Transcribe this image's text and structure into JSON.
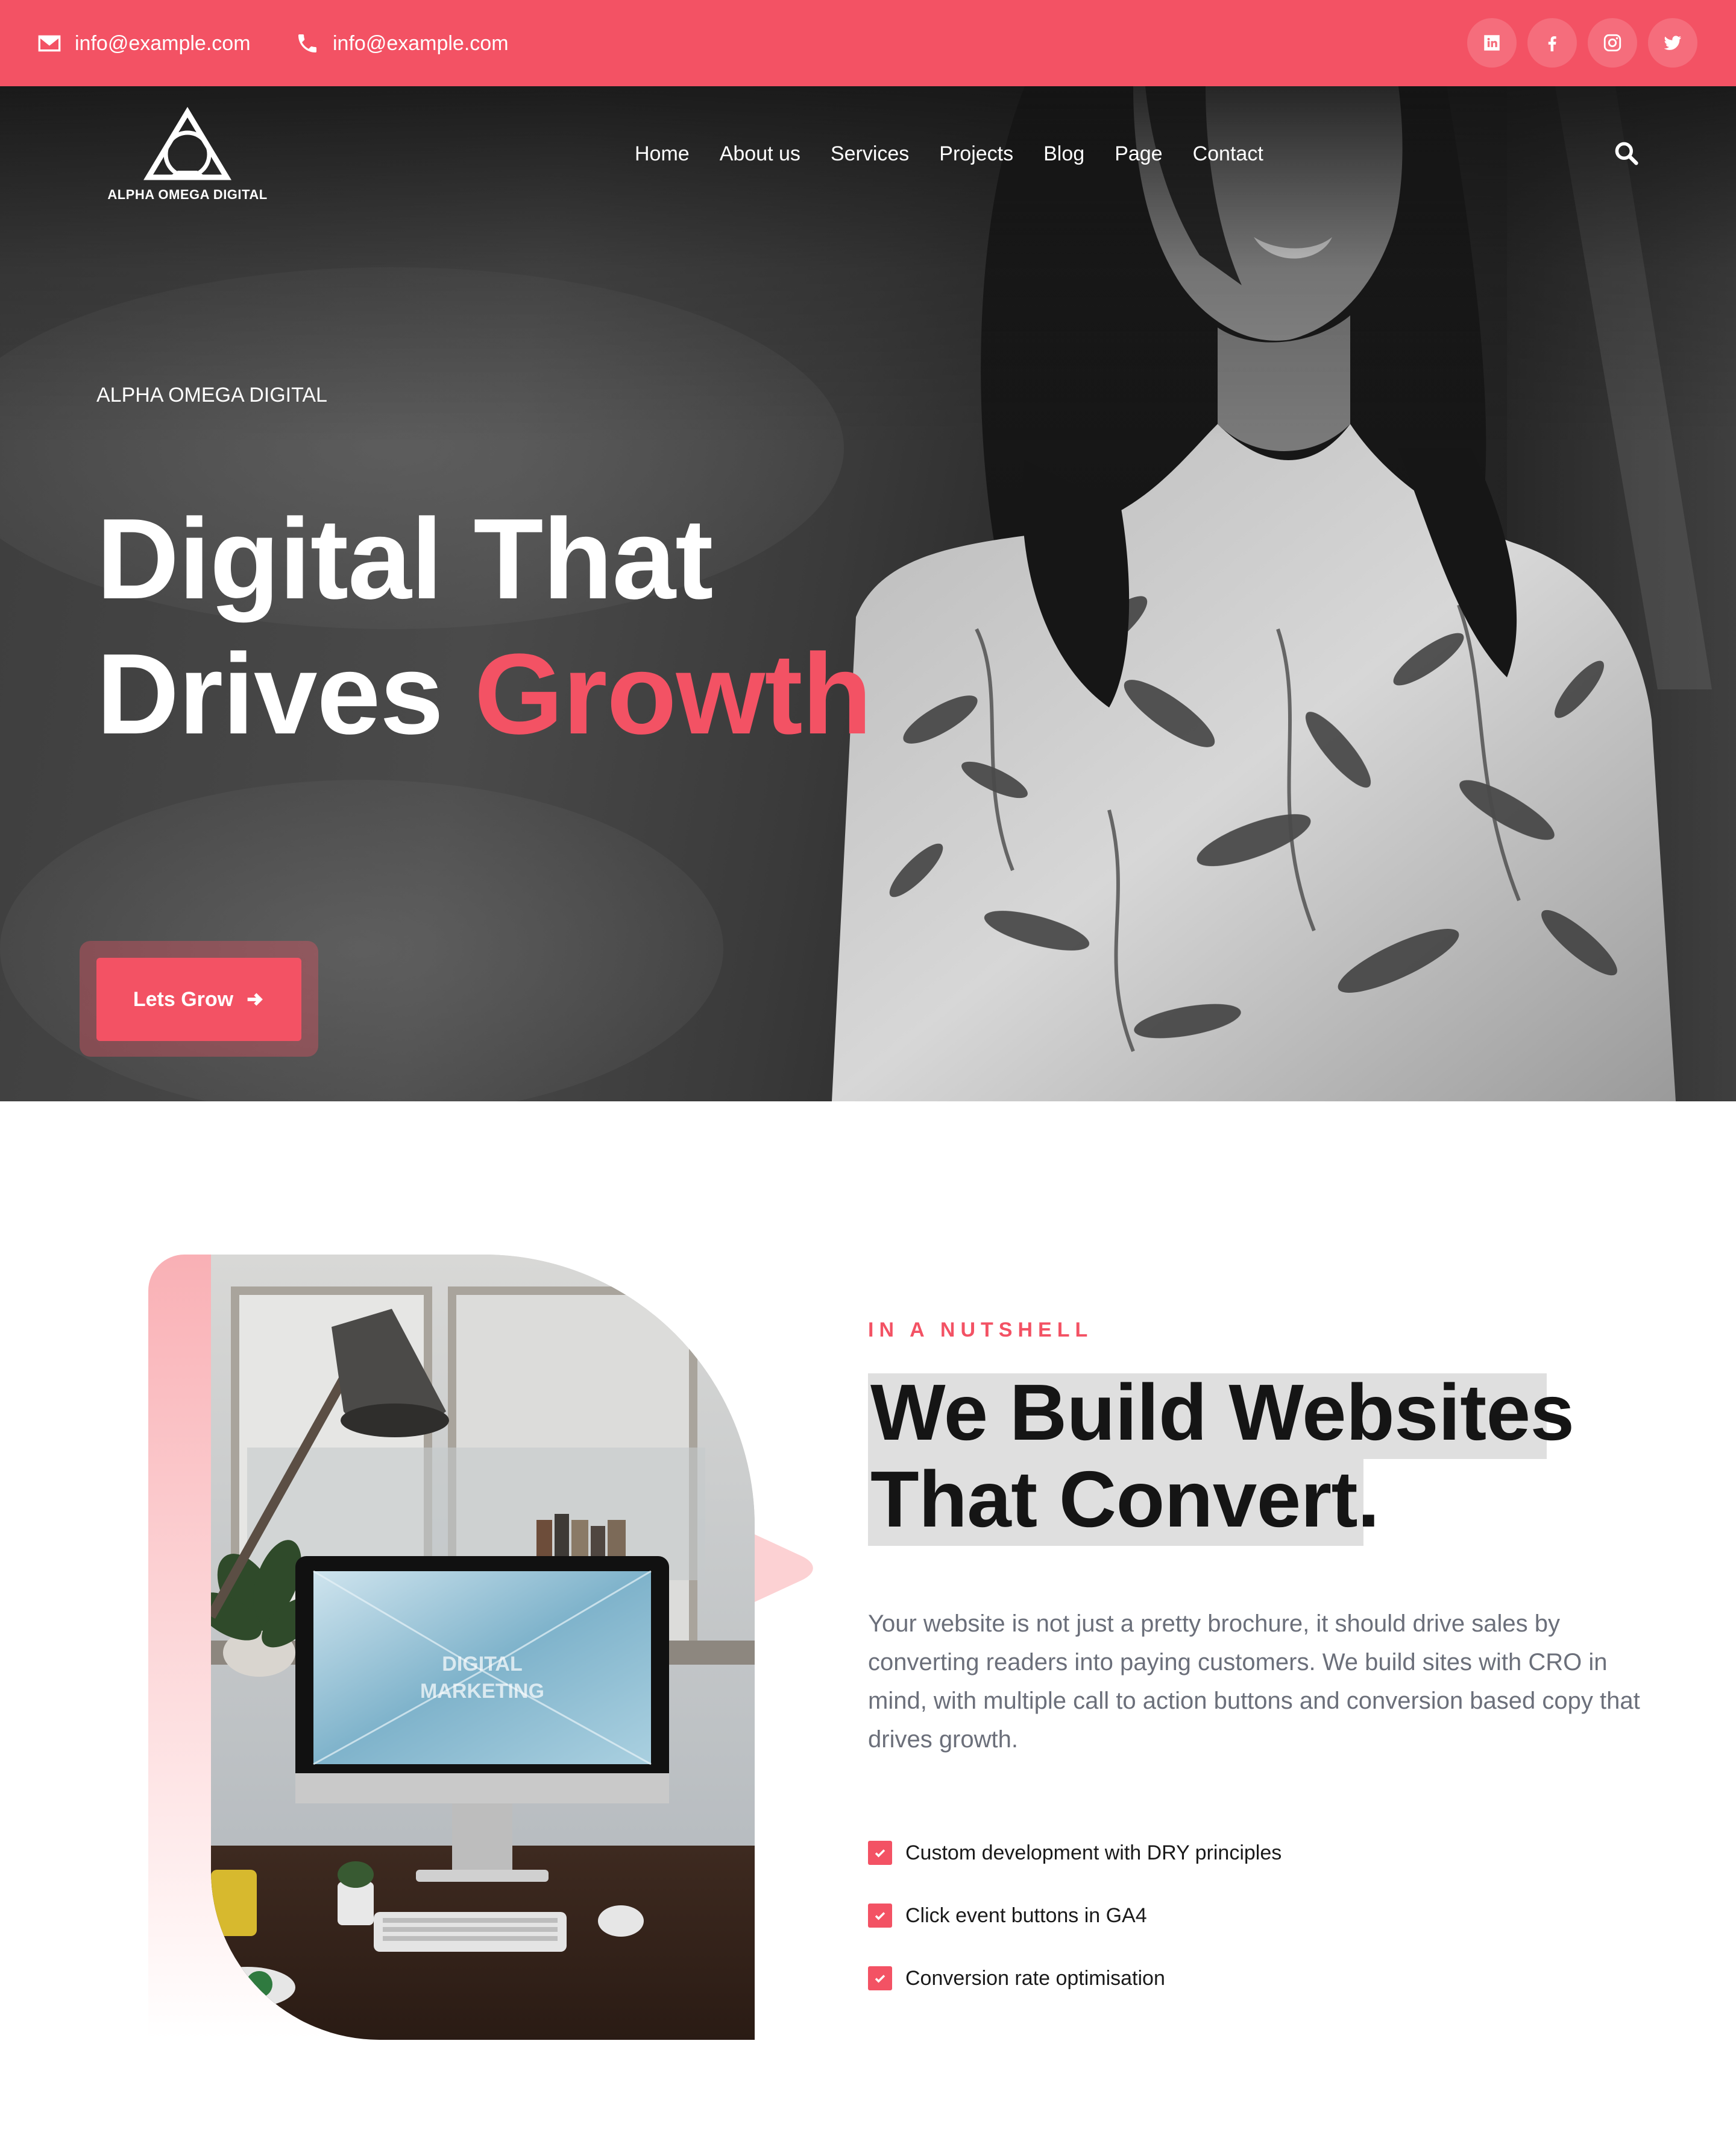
{
  "topbar": {
    "email": "info@example.com",
    "phone": "info@example.com",
    "social": [
      "linkedin-icon",
      "facebook-icon",
      "instagram-icon",
      "twitter-icon"
    ],
    "background": "#f35264"
  },
  "header": {
    "logo_text": "ALPHA OMEGA DIGITAL",
    "nav": [
      "Home",
      "About us",
      "Services",
      "Projects",
      "Blog",
      "Page",
      "Contact"
    ]
  },
  "hero": {
    "kicker": "ALPHA OMEGA DIGITAL",
    "title_line1": "Digital That",
    "title_line2_plain": "Drives ",
    "title_line2_accent": "Growth",
    "cta_label": "Lets Grow",
    "accent": "#f35264"
  },
  "nutshell": {
    "kicker": "IN A NUTSHELL",
    "headline_line1": "We Build Websites",
    "headline_line2": "That Convert.",
    "paragraph": "Your website is not just a pretty brochure, it should drive sales by converting readers into paying customers. We build sites with CRO in mind, with multiple call to action buttons and conversion based copy that drives growth.",
    "checklist": [
      "Custom development with DRY principles",
      "Click event buttons in GA4",
      "Conversion rate optimisation"
    ],
    "screen_text_line1": "DIGITAL",
    "screen_text_line2": "MARKETING"
  }
}
